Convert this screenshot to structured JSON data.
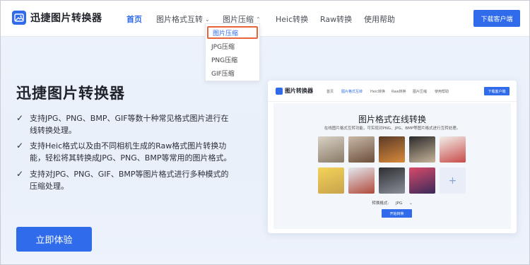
{
  "brand": {
    "name": "迅捷图片转换器",
    "logo_icon": "image-logo-icon",
    "accent": "#2f6bea"
  },
  "nav": {
    "items": [
      {
        "label": "首页",
        "active": true
      },
      {
        "label": "图片格式互转",
        "has_dropdown": true
      },
      {
        "label": "图片压缩",
        "has_dropdown": true,
        "open": true
      },
      {
        "label": "Heic转换"
      },
      {
        "label": "Raw转换"
      },
      {
        "label": "使用帮助"
      }
    ],
    "download_label": "下载客户端"
  },
  "dropdown": {
    "items": [
      {
        "label": "图片压缩",
        "highlighted": true
      },
      {
        "label": "JPG压缩"
      },
      {
        "label": "PNG压缩"
      },
      {
        "label": "GIF压缩"
      }
    ],
    "highlight_color": "#e7643a"
  },
  "hero": {
    "title": "迅捷图片转换器",
    "features": [
      "支持JPG、PNG、BMP、GIF等数十种常见格式图片进行在线转换处理。",
      "支持Heic格式以及由不同相机生成的Raw格式图片转换功能，轻松将其转换成JPG、PNG、BMP等常用的图片格式。",
      "支持对JPG、PNG、GIF、BMP等图片格式进行多种模式的压缩处理。"
    ],
    "cta_label": "立即体验"
  },
  "preview": {
    "logo_text": "图片转换器",
    "nav": [
      "首页",
      "图片格式互转",
      "Heic转换",
      "Raw转换",
      "图片压缩",
      "使用帮助"
    ],
    "nav_active_index": 1,
    "download_label": "下载客户端",
    "title": "图片格式在线转换",
    "subtitle": "在线图片格式互转功能，可实现对PNG、JPG、BMP等图片格式进行互转处理。",
    "format_label": "转换格式:",
    "format_value": "JPG",
    "start_label": "开始转换",
    "thumbnails": [
      {
        "colors": [
          "#d9d2c6",
          "#8a7a66"
        ]
      },
      {
        "colors": [
          "#c9b8a8",
          "#6b4f3a"
        ]
      },
      {
        "colors": [
          "#5a3a28",
          "#d98a3a"
        ]
      },
      {
        "colors": [
          "#2a2a2a",
          "#c8b49a"
        ]
      },
      {
        "colors": [
          "#f2efe9",
          "#c84a4a"
        ]
      },
      {
        "colors": [
          "#f3d35a",
          "#c9a34a"
        ]
      },
      {
        "colors": [
          "#e4e8ee",
          "#b04a3a"
        ]
      },
      {
        "colors": [
          "#2e2e33",
          "#8a8f99"
        ]
      },
      {
        "colors": [
          "#d94a6a",
          "#3a2a5a"
        ]
      }
    ]
  }
}
